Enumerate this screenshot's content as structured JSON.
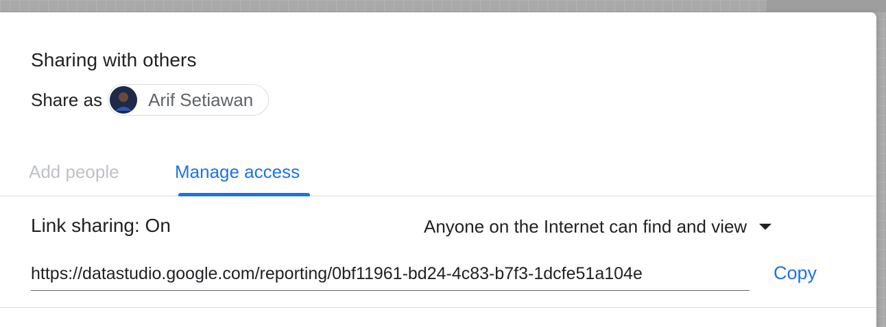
{
  "dialog": {
    "title": "Sharing with others",
    "share_as_label": "Share as",
    "user": {
      "name": "Arif Setiawan",
      "avatar_icon": "user-avatar-photo"
    }
  },
  "tabs": [
    {
      "label": "Add people",
      "active": false
    },
    {
      "label": "Manage access",
      "active": true
    }
  ],
  "link_sharing": {
    "status": "Link sharing: On",
    "access_level": "Anyone on the Internet can find and view",
    "dropdown_icon": "caret-down-icon",
    "url": "https://datastudio.google.com/reporting/0bf11961-bd24-4c83-b7f3-1dcfe51a104e",
    "copy_label": "Copy"
  },
  "colors": {
    "accent": "#1a73e8",
    "text_primary": "#202124",
    "text_secondary": "#5f6368",
    "tab_inactive": "#bdc1c6",
    "divider": "#dadce0"
  }
}
